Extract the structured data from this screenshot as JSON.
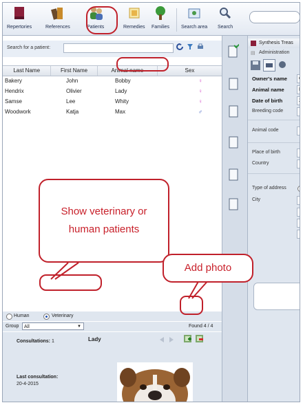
{
  "toolbar": {
    "items": [
      {
        "label": "Repertories",
        "icon": "book-icon"
      },
      {
        "label": "References",
        "icon": "books-icon"
      },
      {
        "label": "Patients",
        "icon": "patients-icon"
      },
      {
        "label": "Remedies",
        "icon": "remedies-icon"
      },
      {
        "label": "Families",
        "icon": "tree-icon"
      },
      {
        "label": "Search area",
        "icon": "search-area-icon"
      },
      {
        "label": "Search",
        "icon": "magnifier-icon"
      }
    ]
  },
  "patients": {
    "search_label": "Search for a patient:",
    "search_value": "",
    "columns": [
      "Last Name",
      "First Name",
      "Animal name",
      "Sex"
    ],
    "rows": [
      {
        "last": "Bakery",
        "first": "John",
        "animal": "Bobby",
        "sex": "♀",
        "sex_color": "#d24fc8"
      },
      {
        "last": "Hendrix",
        "first": "Olivier",
        "animal": "Lady",
        "sex": "♀",
        "sex_color": "#d24fc8"
      },
      {
        "last": "Samse",
        "first": "Lee",
        "animal": "Whity",
        "sex": "♀",
        "sex_color": "#d24fc8"
      },
      {
        "last": "Woodwork",
        "first": "Katja",
        "animal": "Max",
        "sex": "♂",
        "sex_color": "#2348b8"
      }
    ],
    "mode": {
      "human_label": "Human",
      "vet_label": "Veterinary",
      "selected": "Veterinary"
    },
    "group": {
      "label": "Group",
      "value": "All"
    },
    "found": "Found  4 / 4",
    "detail": {
      "name": "Lady",
      "consultations_label": "Consultations:",
      "consultations_value": "1",
      "last_consultation_label": "Last consultation:",
      "last_consultation_value": "20-4-2015"
    }
  },
  "right": {
    "title": "Synthesis Treas",
    "tab": "Administration",
    "fields": {
      "owner_name_label": "Owner's name",
      "owner_name_value": "O",
      "animal_name_label": "Animal name",
      "animal_name_value": "La",
      "dob_label": "Date of birth",
      "dob_value": "20",
      "breeding_label": "Breeding code",
      "animal_code_label": "Animal code",
      "place_label": "Place of birth",
      "country_label": "Country",
      "address_label": "Type of address",
      "city_label": "City"
    }
  },
  "callouts": {
    "mode": "Show veterinary or human patients",
    "photo": "Add photo"
  },
  "colors": {
    "accent": "#c0202a",
    "header": "#dfe6ef"
  }
}
